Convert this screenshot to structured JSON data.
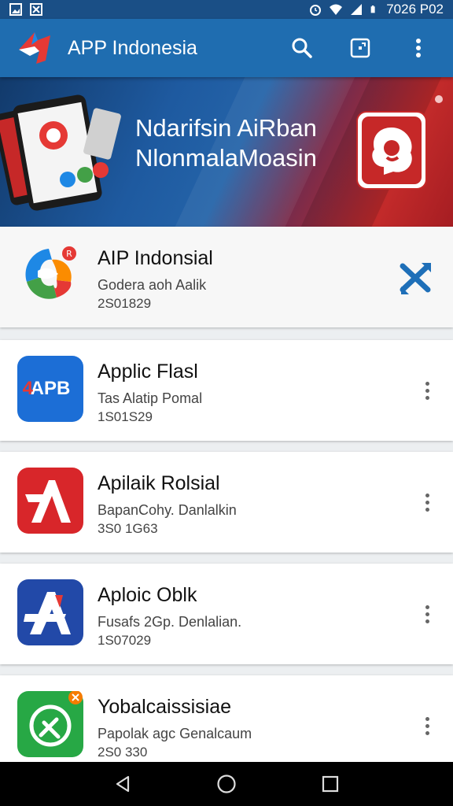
{
  "status_bar": {
    "time": "7026 P02",
    "icons": [
      "notification-image-icon",
      "notification-x-icon",
      "alarm-icon",
      "wifi-icon",
      "signal-icon",
      "battery-icon"
    ]
  },
  "app_bar": {
    "title": "APP Indonesia",
    "actions": [
      "search-icon",
      "open-in-box-icon",
      "more-vert-icon"
    ],
    "color": "#1f6db0"
  },
  "banner": {
    "line1": "Ndarifsin AiRban",
    "line2": "NlonmalaMoasin"
  },
  "apps": [
    {
      "name": "AIP Indonsial",
      "developer": "Godera aoh Aalik",
      "number": "2S01829",
      "featured": true,
      "icon": "colorful-swirl-icon",
      "action": "crossed-arrows-icon"
    },
    {
      "name": "Applic Flasl",
      "developer": "Tas Alatip Pomal",
      "number": "1S01S29",
      "icon_text": "APB",
      "icon": "apb-app-icon",
      "icon_color": "#1c6ed6"
    },
    {
      "name": "Apilaik Rolsial",
      "developer": "BapanCohy. Danlalkin",
      "number": "3S0 1G63",
      "icon": "red-a-app-icon",
      "icon_color": "#d8262a"
    },
    {
      "name": "Aploic Oblk",
      "developer": "Fusafs 2Gp. Denlalian.",
      "number": "1S07029",
      "icon": "blue-a-app-icon",
      "icon_color": "#2249a8"
    },
    {
      "name": "Yobalcaissisiae",
      "developer": "Papolak agc Genalcaum",
      "number": "2S0 330",
      "icon": "green-broom-app-icon",
      "icon_color": "#27a845"
    }
  ],
  "nav_bar": [
    "back-icon",
    "home-icon",
    "recents-icon"
  ]
}
